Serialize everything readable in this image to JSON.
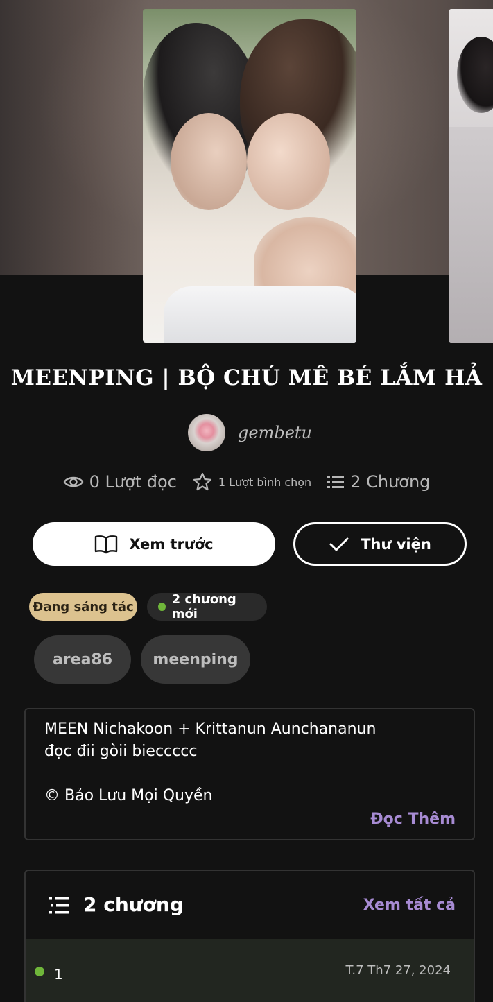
{
  "story": {
    "title": "MEENPING | BỘ CHÚ MÊ BÉ LẮM HẢ",
    "author": "gembetu"
  },
  "stats": {
    "reads": "0 Lượt đọc",
    "votes": "1 Lượt bình chọn",
    "chapters": "2 Chương"
  },
  "buttons": {
    "preview_label": "Xem trước",
    "library_label": "Thư viện"
  },
  "badges": {
    "status": "Đang sáng tác",
    "new_chapters": "2 chương mới"
  },
  "tags": [
    "area86",
    "meenping"
  ],
  "description": {
    "lines": [
      "MEEN Nichakoon + Krittanun Aunchananun",
      "đọc đii gòii bieccccc",
      "© Bảo Lưu Mọi Quyền"
    ],
    "read_more": "Đọc Thêm"
  },
  "chapter_list": {
    "count_label": "2 chương",
    "view_all": "Xem tất cả",
    "items": [
      {
        "number": "1",
        "date": "T.7 Th7 27, 2024"
      }
    ]
  },
  "colors": {
    "background": "#121212",
    "accent": "#a78bd3",
    "status_badge": "#dcc28f",
    "new_dot": "#6fb63a"
  },
  "icons": [
    "eye-icon",
    "star-icon",
    "list-icon",
    "book-open-icon",
    "check-icon"
  ]
}
